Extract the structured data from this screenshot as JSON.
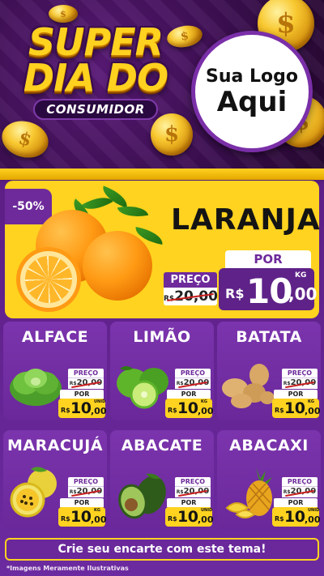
{
  "header": {
    "title_line1": "SUPER",
    "title_line2": "DIA DO",
    "title_sub": "CONSUMIDOR",
    "logo_line1": "Sua Logo",
    "logo_line2": "Aqui"
  },
  "featured": {
    "discount": "-50%",
    "name": "LARANJA",
    "preco_label": "PREÇO",
    "old_currency": "R$",
    "old_price": "20,00",
    "por_label": "POR",
    "currency": "R$",
    "price_int": "10",
    "price_dec": ",00",
    "unit": "KG"
  },
  "products": [
    {
      "name": "ALFACE",
      "preco_label": "PREÇO",
      "old_currency": "R$",
      "old_price": "20,00",
      "por_label": "POR",
      "currency": "R$",
      "price_int": "10",
      "price_dec": ",00",
      "unit": "UNID"
    },
    {
      "name": "LIMÃO",
      "preco_label": "PREÇO",
      "old_currency": "R$",
      "old_price": "20,00",
      "por_label": "POR",
      "currency": "R$",
      "price_int": "10",
      "price_dec": ",00",
      "unit": "KG"
    },
    {
      "name": "BATATA",
      "preco_label": "PREÇO",
      "old_currency": "R$",
      "old_price": "20,00",
      "por_label": "POR",
      "currency": "R$",
      "price_int": "10",
      "price_dec": ",00",
      "unit": "KG"
    },
    {
      "name": "MARACUJÁ",
      "preco_label": "PREÇO",
      "old_currency": "R$",
      "old_price": "20,00",
      "por_label": "POR",
      "currency": "R$",
      "price_int": "10",
      "price_dec": ",00",
      "unit": "KG"
    },
    {
      "name": "ABACATE",
      "preco_label": "PREÇO",
      "old_currency": "R$",
      "old_price": "20,00",
      "por_label": "POR",
      "currency": "R$",
      "price_int": "10",
      "price_dec": ",00",
      "unit": "UNID"
    },
    {
      "name": "ABACAXI",
      "preco_label": "PREÇO",
      "old_currency": "R$",
      "old_price": "20,00",
      "por_label": "POR",
      "currency": "R$",
      "price_int": "10",
      "price_dec": ",00",
      "unit": "UNID"
    }
  ],
  "footer": {
    "cta": "Crie seu encarte com este tema!",
    "note": "*Imagens Meramente Ilustrativas"
  },
  "colors": {
    "purple": "#6e2a9b",
    "yellow": "#ffd31f",
    "dark_purple": "#3a0f4f"
  }
}
